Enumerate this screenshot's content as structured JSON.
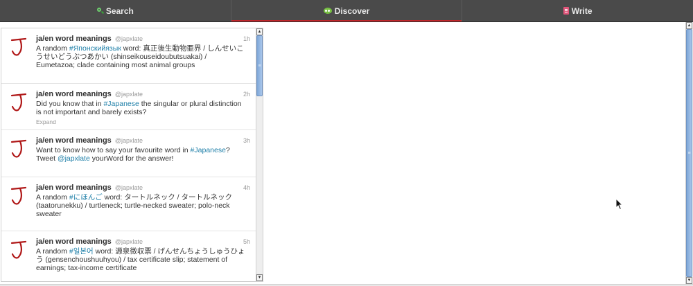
{
  "tabs": [
    {
      "label": "Search",
      "icon": "search-icon"
    },
    {
      "label": "Discover",
      "icon": "discover-icon"
    },
    {
      "label": "Write",
      "icon": "write-icon"
    }
  ],
  "tweets": [
    {
      "name": "ja/en word meanings",
      "handle": "@japxlate",
      "time": "1h",
      "text_before": "A random ",
      "hashtag": "#Японскийязык",
      "text_after": " word: 真正後生動物亜界 / しんせいこうせいどうぶつあかい (shinseikouseidoubutsuakai) / Eumetazoa; clade containing most animal groups",
      "expand": ""
    },
    {
      "name": "ja/en word meanings",
      "handle": "@japxlate",
      "time": "2h",
      "text_before": "Did you know that in ",
      "hashtag": "#Japanese",
      "text_after": " the singular or plural distinction is not important and barely exists?",
      "expand": "Expand"
    },
    {
      "name": "ja/en word meanings",
      "handle": "@japxlate",
      "time": "3h",
      "text_before": "Want to know how to say your favourite word in ",
      "hashtag": "#Japanese",
      "text_mid": "? Tweet ",
      "mention": "@japxlate",
      "text_after": " yourWord for the answer!",
      "expand": ""
    },
    {
      "name": "ja/en word meanings",
      "handle": "@japxlate",
      "time": "4h",
      "text_before": "A random ",
      "hashtag": "#にほんご",
      "text_after": " word: タートルネック / タートルネック (taatorunekku) / turtleneck; turtle-necked sweater; polo-neck sweater",
      "expand": ""
    },
    {
      "name": "ja/en word meanings",
      "handle": "@japxlate",
      "time": "5h",
      "text_before": "A random ",
      "hashtag": "#일본어",
      "text_after": " word: 源泉徴収票 / げんせんちょうしゅうひょう (gensenchoushuuhyou) / tax certificate slip; statement of earnings; tax-income certificate",
      "expand": ""
    }
  ],
  "scroll": {
    "up_arrow": "▲",
    "down_arrow": "▼",
    "grip": "≡"
  },
  "colors": {
    "topbar": "#4a4a4a",
    "active_underline": "#c0262b",
    "link": "#1e7fa8",
    "avatar_stroke": "#b01818"
  }
}
